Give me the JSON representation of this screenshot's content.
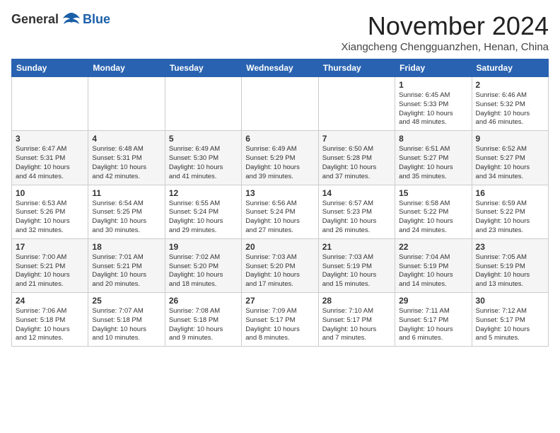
{
  "header": {
    "logo_general": "General",
    "logo_blue": "Blue",
    "month": "November 2024",
    "location": "Xiangcheng Chengguanzhen, Henan, China"
  },
  "weekdays": [
    "Sunday",
    "Monday",
    "Tuesday",
    "Wednesday",
    "Thursday",
    "Friday",
    "Saturday"
  ],
  "weeks": [
    [
      {
        "day": "",
        "info": ""
      },
      {
        "day": "",
        "info": ""
      },
      {
        "day": "",
        "info": ""
      },
      {
        "day": "",
        "info": ""
      },
      {
        "day": "",
        "info": ""
      },
      {
        "day": "1",
        "info": "Sunrise: 6:45 AM\nSunset: 5:33 PM\nDaylight: 10 hours\nand 48 minutes."
      },
      {
        "day": "2",
        "info": "Sunrise: 6:46 AM\nSunset: 5:32 PM\nDaylight: 10 hours\nand 46 minutes."
      }
    ],
    [
      {
        "day": "3",
        "info": "Sunrise: 6:47 AM\nSunset: 5:31 PM\nDaylight: 10 hours\nand 44 minutes."
      },
      {
        "day": "4",
        "info": "Sunrise: 6:48 AM\nSunset: 5:31 PM\nDaylight: 10 hours\nand 42 minutes."
      },
      {
        "day": "5",
        "info": "Sunrise: 6:49 AM\nSunset: 5:30 PM\nDaylight: 10 hours\nand 41 minutes."
      },
      {
        "day": "6",
        "info": "Sunrise: 6:49 AM\nSunset: 5:29 PM\nDaylight: 10 hours\nand 39 minutes."
      },
      {
        "day": "7",
        "info": "Sunrise: 6:50 AM\nSunset: 5:28 PM\nDaylight: 10 hours\nand 37 minutes."
      },
      {
        "day": "8",
        "info": "Sunrise: 6:51 AM\nSunset: 5:27 PM\nDaylight: 10 hours\nand 35 minutes."
      },
      {
        "day": "9",
        "info": "Sunrise: 6:52 AM\nSunset: 5:27 PM\nDaylight: 10 hours\nand 34 minutes."
      }
    ],
    [
      {
        "day": "10",
        "info": "Sunrise: 6:53 AM\nSunset: 5:26 PM\nDaylight: 10 hours\nand 32 minutes."
      },
      {
        "day": "11",
        "info": "Sunrise: 6:54 AM\nSunset: 5:25 PM\nDaylight: 10 hours\nand 30 minutes."
      },
      {
        "day": "12",
        "info": "Sunrise: 6:55 AM\nSunset: 5:24 PM\nDaylight: 10 hours\nand 29 minutes."
      },
      {
        "day": "13",
        "info": "Sunrise: 6:56 AM\nSunset: 5:24 PM\nDaylight: 10 hours\nand 27 minutes."
      },
      {
        "day": "14",
        "info": "Sunrise: 6:57 AM\nSunset: 5:23 PM\nDaylight: 10 hours\nand 26 minutes."
      },
      {
        "day": "15",
        "info": "Sunrise: 6:58 AM\nSunset: 5:22 PM\nDaylight: 10 hours\nand 24 minutes."
      },
      {
        "day": "16",
        "info": "Sunrise: 6:59 AM\nSunset: 5:22 PM\nDaylight: 10 hours\nand 23 minutes."
      }
    ],
    [
      {
        "day": "17",
        "info": "Sunrise: 7:00 AM\nSunset: 5:21 PM\nDaylight: 10 hours\nand 21 minutes."
      },
      {
        "day": "18",
        "info": "Sunrise: 7:01 AM\nSunset: 5:21 PM\nDaylight: 10 hours\nand 20 minutes."
      },
      {
        "day": "19",
        "info": "Sunrise: 7:02 AM\nSunset: 5:20 PM\nDaylight: 10 hours\nand 18 minutes."
      },
      {
        "day": "20",
        "info": "Sunrise: 7:03 AM\nSunset: 5:20 PM\nDaylight: 10 hours\nand 17 minutes."
      },
      {
        "day": "21",
        "info": "Sunrise: 7:03 AM\nSunset: 5:19 PM\nDaylight: 10 hours\nand 15 minutes."
      },
      {
        "day": "22",
        "info": "Sunrise: 7:04 AM\nSunset: 5:19 PM\nDaylight: 10 hours\nand 14 minutes."
      },
      {
        "day": "23",
        "info": "Sunrise: 7:05 AM\nSunset: 5:19 PM\nDaylight: 10 hours\nand 13 minutes."
      }
    ],
    [
      {
        "day": "24",
        "info": "Sunrise: 7:06 AM\nSunset: 5:18 PM\nDaylight: 10 hours\nand 12 minutes."
      },
      {
        "day": "25",
        "info": "Sunrise: 7:07 AM\nSunset: 5:18 PM\nDaylight: 10 hours\nand 10 minutes."
      },
      {
        "day": "26",
        "info": "Sunrise: 7:08 AM\nSunset: 5:18 PM\nDaylight: 10 hours\nand 9 minutes."
      },
      {
        "day": "27",
        "info": "Sunrise: 7:09 AM\nSunset: 5:17 PM\nDaylight: 10 hours\nand 8 minutes."
      },
      {
        "day": "28",
        "info": "Sunrise: 7:10 AM\nSunset: 5:17 PM\nDaylight: 10 hours\nand 7 minutes."
      },
      {
        "day": "29",
        "info": "Sunrise: 7:11 AM\nSunset: 5:17 PM\nDaylight: 10 hours\nand 6 minutes."
      },
      {
        "day": "30",
        "info": "Sunrise: 7:12 AM\nSunset: 5:17 PM\nDaylight: 10 hours\nand 5 minutes."
      }
    ]
  ]
}
